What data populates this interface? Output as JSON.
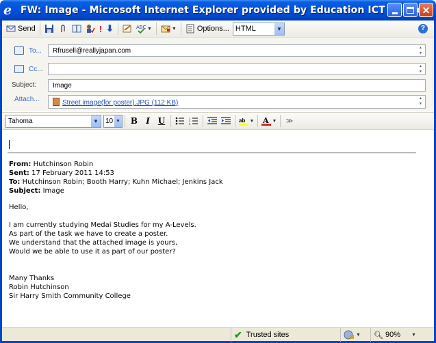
{
  "window": {
    "title": "FW: Image - Microsoft Internet Explorer provided by Education ICT Service"
  },
  "toolbar": {
    "send_label": "Send",
    "options_label": "Options...",
    "format_value": "HTML"
  },
  "header": {
    "to_label": "To...",
    "to_value": "Rfrusell@reallyjapan.com",
    "cc_label": "Cc...",
    "cc_value": "",
    "subject_label": "Subject:",
    "subject_value": "Image",
    "attach_label": "Attach...",
    "attachment": "Street image(for poster).JPG (112 KB)"
  },
  "format": {
    "font": "Tahoma",
    "size": "10"
  },
  "original": {
    "from_label": "From:",
    "from_value": "Hutchinson Robin",
    "sent_label": "Sent:",
    "sent_value": "17 February 2011 14:53",
    "to_label": "To:",
    "to_value": "Hutchinson Robin; Booth Harry; Kuhn Michael; Jenkins Jack",
    "subject_label": "Subject:",
    "subject_value": "Image"
  },
  "message": {
    "lines": [
      "Hello,",
      "",
      "I am currently studying Medai Studies for my A-Levels.",
      "As part of the task we have to create a poster.",
      "We understand that the attached image is yours,",
      "Would we be able to use it as part of our poster?",
      "",
      "",
      "Many Thanks",
      "Robin Hutchinson",
      "Sir Harry Smith Community College"
    ]
  },
  "status": {
    "zone": "Trusted sites",
    "zoom": "90%"
  },
  "colors": {
    "titlebar": "#0050dc",
    "link": "#1e4fb5",
    "check": "#1a9a1a"
  }
}
